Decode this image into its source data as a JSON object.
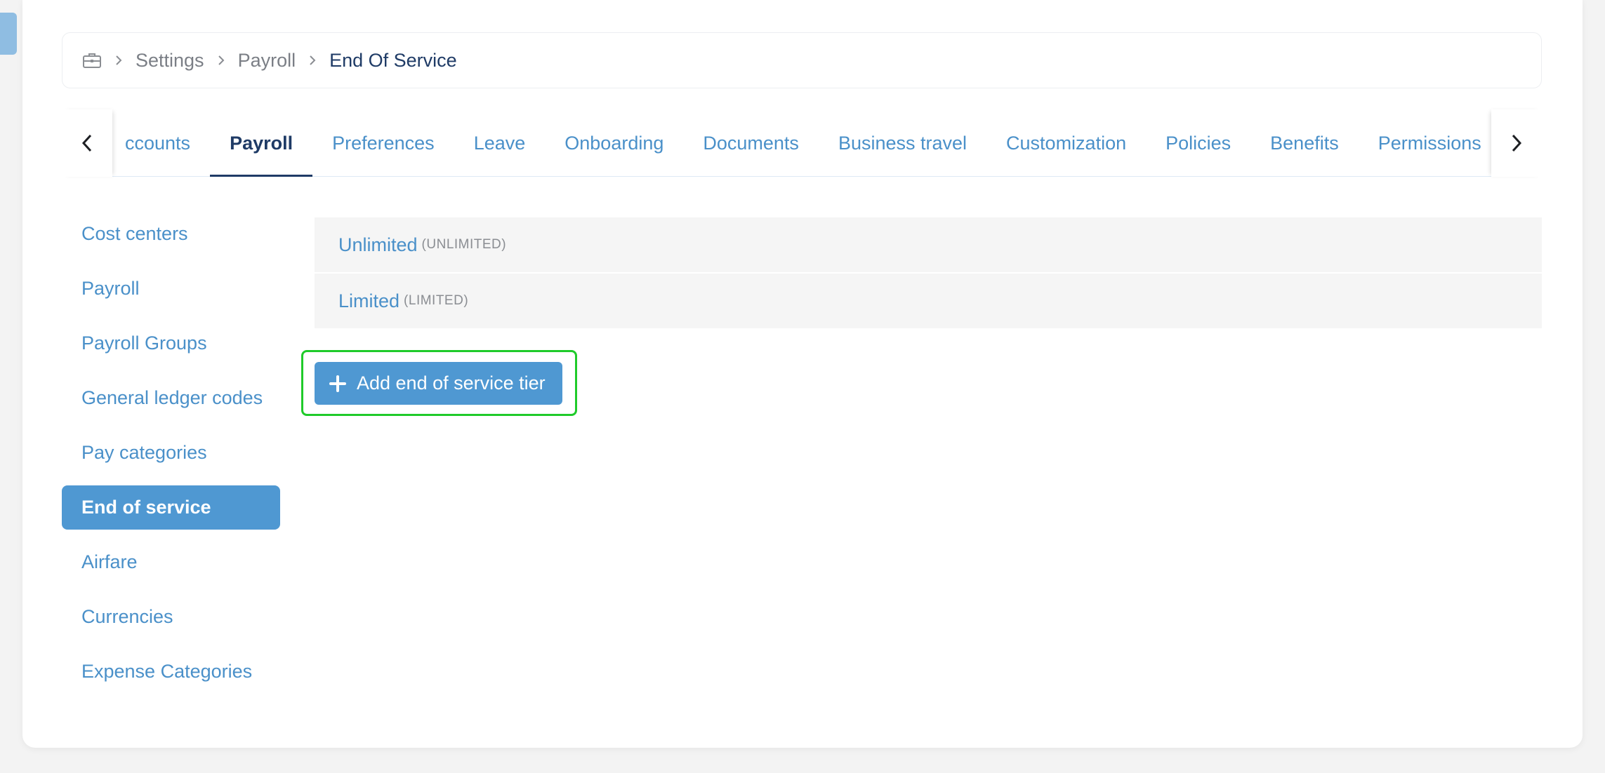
{
  "breadcrumb": {
    "icon": "briefcase-icon",
    "items": [
      "Settings",
      "Payroll"
    ],
    "current": "End Of Service"
  },
  "tabs": {
    "items": [
      {
        "label": "ccounts",
        "active": false
      },
      {
        "label": "Payroll",
        "active": true
      },
      {
        "label": "Preferences",
        "active": false
      },
      {
        "label": "Leave",
        "active": false
      },
      {
        "label": "Onboarding",
        "active": false
      },
      {
        "label": "Documents",
        "active": false
      },
      {
        "label": "Business travel",
        "active": false
      },
      {
        "label": "Customization",
        "active": false
      },
      {
        "label": "Policies",
        "active": false
      },
      {
        "label": "Benefits",
        "active": false
      },
      {
        "label": "Permissions",
        "active": false
      }
    ]
  },
  "sidebar": {
    "items": [
      {
        "label": "Cost centers",
        "active": false
      },
      {
        "label": "Payroll",
        "active": false
      },
      {
        "label": "Payroll Groups",
        "active": false
      },
      {
        "label": "General ledger codes",
        "active": false
      },
      {
        "label": "Pay categories",
        "active": false
      },
      {
        "label": "End of service",
        "active": true
      },
      {
        "label": "Airfare",
        "active": false
      },
      {
        "label": "Currencies",
        "active": false
      },
      {
        "label": "Expense Categories",
        "active": false
      }
    ]
  },
  "tiers": [
    {
      "name": "Unlimited",
      "code": "(UNLIMITED)"
    },
    {
      "name": "Limited",
      "code": "(LIMITED)"
    }
  ],
  "add_button": {
    "label": "Add end of service tier"
  },
  "colors": {
    "accent": "#4f98d2",
    "link": "#4a90c9",
    "dark": "#1f3b66",
    "highlight": "#1fcb2a"
  }
}
